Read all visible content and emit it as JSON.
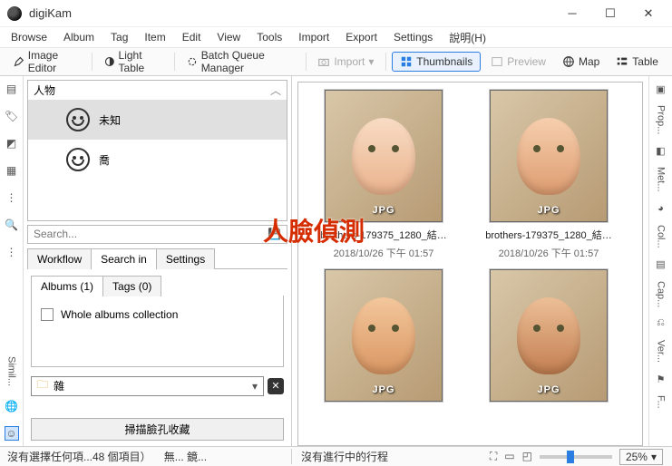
{
  "window": {
    "title": "digiKam"
  },
  "menu": [
    "Browse",
    "Album",
    "Tag",
    "Item",
    "Edit",
    "View",
    "Tools",
    "Import",
    "Export",
    "Settings",
    "說明(H)"
  ],
  "toolbar": {
    "image_editor": "Image Editor",
    "light_table": "Light Table",
    "bqm": "Batch Queue Manager",
    "import": "Import",
    "thumbnails": "Thumbnails",
    "preview": "Preview",
    "map": "Map",
    "table": "Table"
  },
  "left": {
    "people": {
      "header": "人物",
      "items": [
        {
          "label": "未知",
          "selected": true
        },
        {
          "label": "喬",
          "selected": false
        }
      ]
    },
    "search_placeholder": "Search...",
    "tabs": [
      "Workflow",
      "Search in",
      "Settings"
    ],
    "tabs_active": 1,
    "subtabs": [
      "Albums (1)",
      "Tags (0)"
    ],
    "subtabs_active": 0,
    "whole_albums": "Whole albums collection",
    "combo_value": "雜",
    "scan_btn": "掃描臉孔收藏",
    "rail_bottom": "Simil..."
  },
  "thumbs": [
    {
      "fmt": "JPG",
      "name": "brothers-179375_1280_結…",
      "date": "2018/10/26 下午 01:57"
    },
    {
      "fmt": "JPG",
      "name": "brothers-179375_1280_結…",
      "date": "2018/10/26 下午 01:57"
    },
    {
      "fmt": "JPG",
      "name": "",
      "date": ""
    },
    {
      "fmt": "JPG",
      "name": "",
      "date": ""
    }
  ],
  "right_rail": [
    "Prop...",
    "Met...",
    "Col...",
    "Cap...",
    "Ver...",
    "F..."
  ],
  "status": {
    "left1": "沒有選擇任何項...48 個項目）",
    "left2": "無... 鏡...",
    "center": "沒有進行中的行程",
    "zoom": "25%"
  },
  "annotation": "人臉偵測"
}
